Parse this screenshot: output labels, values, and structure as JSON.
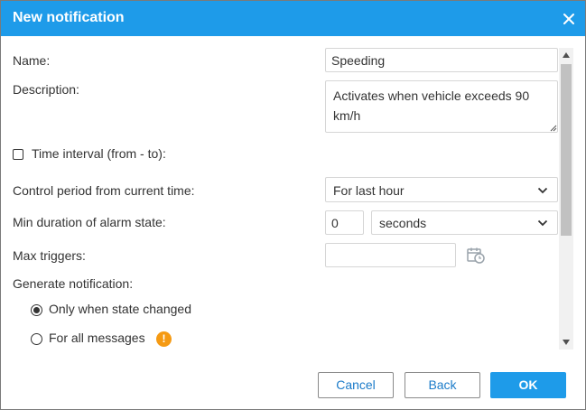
{
  "dialog": {
    "title": "New notification"
  },
  "form": {
    "name_label": "Name:",
    "name_value": "Speeding",
    "description_label": "Description:",
    "description_value": "Activates when vehicle exceeds 90 km/h",
    "time_interval_label": "Time interval (from - to):",
    "time_interval_checked": false,
    "control_period_label": "Control period from current time:",
    "control_period_value": "For last hour",
    "min_duration_label": "Min duration of alarm state:",
    "min_duration_value": "0",
    "min_duration_unit": "seconds",
    "max_triggers_label": "Max triggers:",
    "max_triggers_value": "",
    "generate_label": "Generate notification:",
    "generate_options": [
      {
        "label": "Only when state changed",
        "selected": true
      },
      {
        "label": "For all messages",
        "selected": false
      }
    ],
    "warning_glyph": "!"
  },
  "buttons": {
    "cancel": "Cancel",
    "back": "Back",
    "ok": "OK"
  },
  "colors": {
    "accent": "#1e9be9",
    "link_text": "#1b7bc9",
    "warning": "#f59a13"
  },
  "icons": {
    "close": "close-icon",
    "dropdown": "chevron-down-icon",
    "calendar": "calendar-clock-icon",
    "warning": "warning-icon"
  }
}
